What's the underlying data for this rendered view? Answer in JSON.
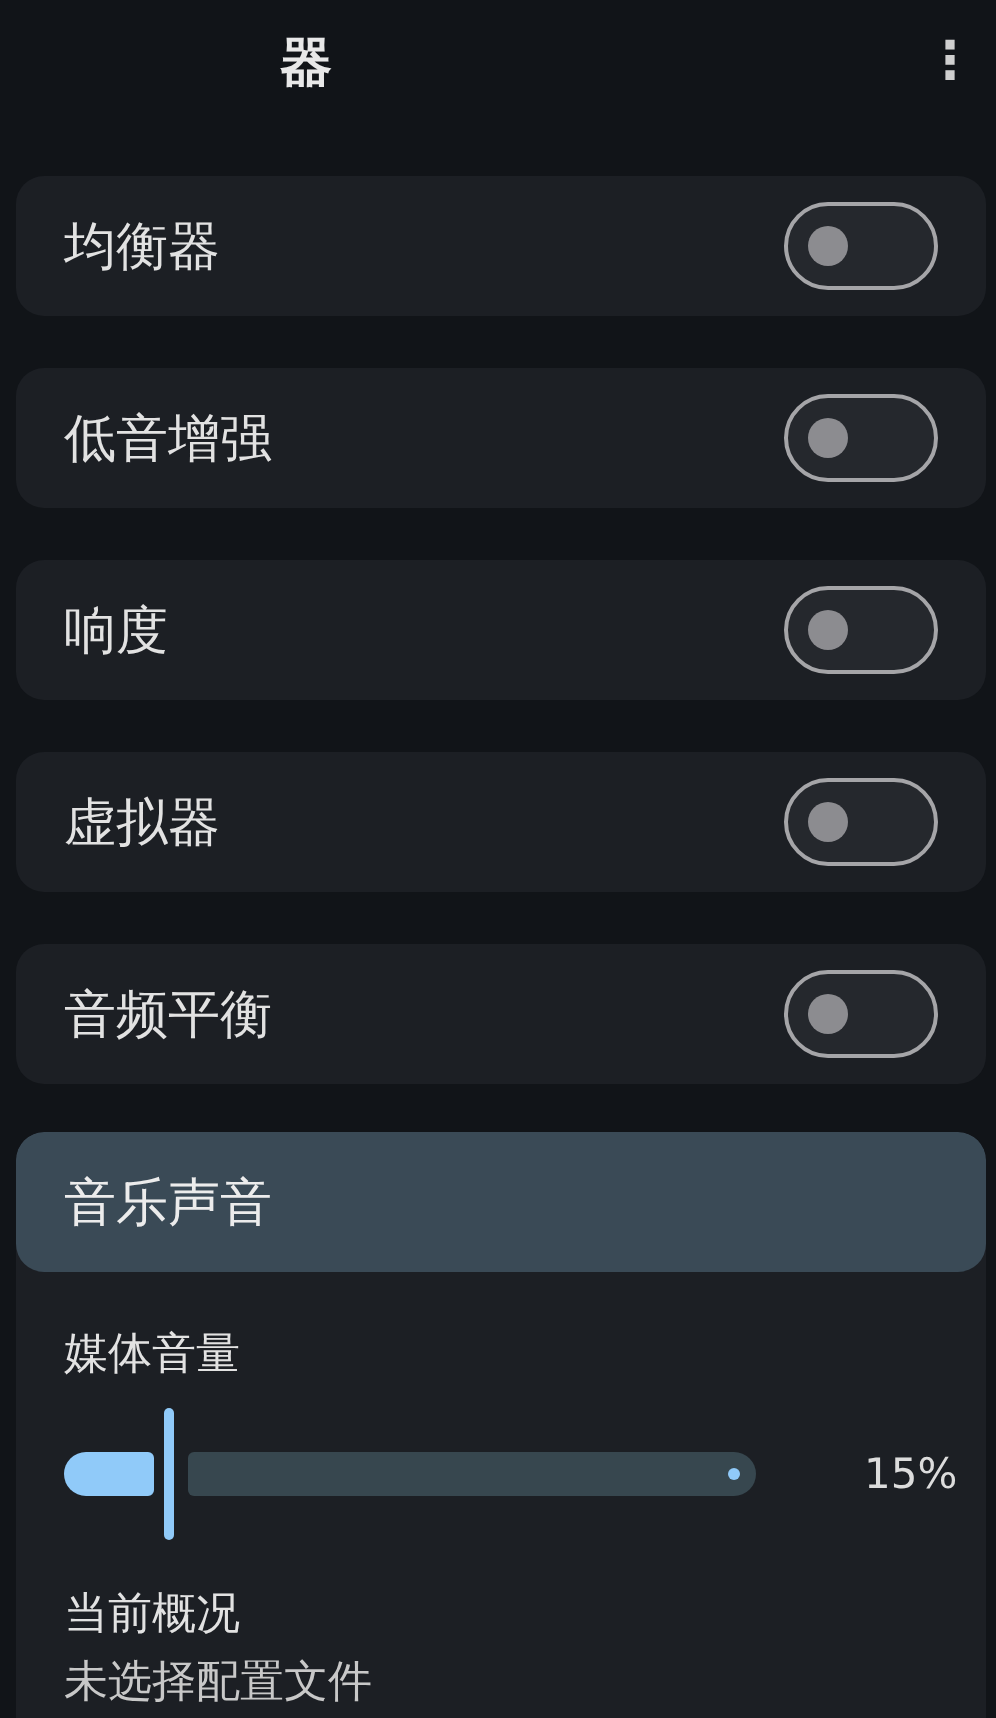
{
  "app_bar": {
    "title": "器",
    "menu": "⋮"
  },
  "effects": [
    {
      "label": "均衡器",
      "on": false
    },
    {
      "label": "低音增强",
      "on": false
    },
    {
      "label": "响度",
      "on": false
    },
    {
      "label": "虚拟器",
      "on": false
    },
    {
      "label": "音频平衡",
      "on": false
    }
  ],
  "sound_panel": {
    "title": "音乐声音",
    "volume_label": "媒体音量",
    "volume": {
      "level": 0.15,
      "reading": "15%"
    },
    "profile_label": "当前概况",
    "profile_value": "未选择配置文件"
  }
}
